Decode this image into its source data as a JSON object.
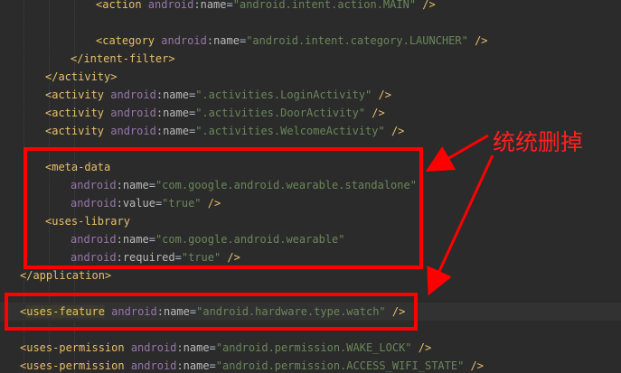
{
  "annotation": {
    "note_text": "统统删掉",
    "color": "#ff0000"
  },
  "code_lines": [
    {
      "indent": 106,
      "tokens": [
        {
          "t": "tag",
          "v": "<action "
        },
        {
          "t": "ns",
          "v": "android"
        },
        {
          "t": "eq",
          "v": ":"
        },
        {
          "t": "attr",
          "v": "name"
        },
        {
          "t": "eq",
          "v": "="
        },
        {
          "t": "val",
          "v": "\"android.intent.action.MAIN\""
        },
        {
          "t": "tag",
          "v": " />"
        }
      ]
    },
    {
      "indent": 0,
      "tokens": []
    },
    {
      "indent": 106,
      "tokens": [
        {
          "t": "tag",
          "v": "<category "
        },
        {
          "t": "ns",
          "v": "android"
        },
        {
          "t": "eq",
          "v": ":"
        },
        {
          "t": "attr",
          "v": "name"
        },
        {
          "t": "eq",
          "v": "="
        },
        {
          "t": "val",
          "v": "\"android.intent.category.LAUNCHER\""
        },
        {
          "t": "tag",
          "v": " />"
        }
      ]
    },
    {
      "indent": 78,
      "tokens": [
        {
          "t": "tag",
          "v": "</intent-filter>"
        }
      ]
    },
    {
      "indent": 50,
      "tokens": [
        {
          "t": "tag",
          "v": "</activity>"
        }
      ]
    },
    {
      "indent": 50,
      "tokens": [
        {
          "t": "tag",
          "v": "<activity "
        },
        {
          "t": "ns",
          "v": "android"
        },
        {
          "t": "eq",
          "v": ":"
        },
        {
          "t": "attr",
          "v": "name"
        },
        {
          "t": "eq",
          "v": "="
        },
        {
          "t": "val",
          "v": "\".activities.LoginActivity\""
        },
        {
          "t": "tag",
          "v": " />"
        }
      ]
    },
    {
      "indent": 50,
      "tokens": [
        {
          "t": "tag",
          "v": "<activity "
        },
        {
          "t": "ns",
          "v": "android"
        },
        {
          "t": "eq",
          "v": ":"
        },
        {
          "t": "attr",
          "v": "name"
        },
        {
          "t": "eq",
          "v": "="
        },
        {
          "t": "val",
          "v": "\".activities.DoorActivity\""
        },
        {
          "t": "tag",
          "v": " />"
        }
      ]
    },
    {
      "indent": 50,
      "tokens": [
        {
          "t": "tag",
          "v": "<activity "
        },
        {
          "t": "ns",
          "v": "android"
        },
        {
          "t": "eq",
          "v": ":"
        },
        {
          "t": "attr",
          "v": "name"
        },
        {
          "t": "eq",
          "v": "="
        },
        {
          "t": "val",
          "v": "\".activities.WelcomeActivity\""
        },
        {
          "t": "tag",
          "v": " />"
        }
      ]
    },
    {
      "indent": 0,
      "tokens": []
    },
    {
      "indent": 50,
      "tokens": [
        {
          "t": "tag",
          "v": "<meta-data"
        }
      ]
    },
    {
      "indent": 78,
      "tokens": [
        {
          "t": "ns",
          "v": "android"
        },
        {
          "t": "eq",
          "v": ":"
        },
        {
          "t": "attr",
          "v": "name"
        },
        {
          "t": "eq",
          "v": "="
        },
        {
          "t": "val",
          "v": "\"com.google.android.wearable.standalone\""
        }
      ]
    },
    {
      "indent": 78,
      "tokens": [
        {
          "t": "ns",
          "v": "android"
        },
        {
          "t": "eq",
          "v": ":"
        },
        {
          "t": "attr",
          "v": "value"
        },
        {
          "t": "eq",
          "v": "="
        },
        {
          "t": "val",
          "v": "\"true\""
        },
        {
          "t": "tag",
          "v": " />"
        }
      ]
    },
    {
      "indent": 50,
      "tokens": [
        {
          "t": "tag",
          "v": "<uses-library"
        }
      ]
    },
    {
      "indent": 78,
      "tokens": [
        {
          "t": "ns",
          "v": "android"
        },
        {
          "t": "eq",
          "v": ":"
        },
        {
          "t": "attr",
          "v": "name"
        },
        {
          "t": "eq",
          "v": "="
        },
        {
          "t": "val",
          "v": "\"com.google.android.wearable\""
        }
      ]
    },
    {
      "indent": 78,
      "tokens": [
        {
          "t": "ns",
          "v": "android"
        },
        {
          "t": "eq",
          "v": ":"
        },
        {
          "t": "attr",
          "v": "required"
        },
        {
          "t": "eq",
          "v": "="
        },
        {
          "t": "val",
          "v": "\"true\""
        },
        {
          "t": "tag",
          "v": " />"
        }
      ]
    },
    {
      "indent": 22,
      "tokens": [
        {
          "t": "tag",
          "v": "</application>"
        }
      ]
    },
    {
      "indent": 0,
      "tokens": []
    },
    {
      "indent": 22,
      "highlight": true,
      "tokens": [
        {
          "t": "tag",
          "v": "<"
        },
        {
          "t": "kw-hl",
          "v": "uses-feature"
        },
        {
          "t": "tag",
          "v": " "
        },
        {
          "t": "ns",
          "v": "android"
        },
        {
          "t": "eq",
          "v": ":"
        },
        {
          "t": "attr",
          "v": "name"
        },
        {
          "t": "eq",
          "v": "="
        },
        {
          "t": "val",
          "v": "\"android.hardware.type.watch\""
        },
        {
          "t": "tag",
          "v": " />"
        }
      ]
    },
    {
      "indent": 0,
      "tokens": []
    },
    {
      "indent": 22,
      "tokens": [
        {
          "t": "tag",
          "v": "<uses-permission "
        },
        {
          "t": "ns",
          "v": "android"
        },
        {
          "t": "eq",
          "v": ":"
        },
        {
          "t": "attr",
          "v": "name"
        },
        {
          "t": "eq",
          "v": "="
        },
        {
          "t": "val",
          "v": "\"android.permission.WAKE_LOCK\""
        },
        {
          "t": "tag",
          "v": " />"
        }
      ]
    },
    {
      "indent": 22,
      "tokens": [
        {
          "t": "tag",
          "v": "<uses-permission "
        },
        {
          "t": "ns",
          "v": "android"
        },
        {
          "t": "eq",
          "v": ":"
        },
        {
          "t": "attr",
          "v": "name"
        },
        {
          "t": "eq",
          "v": "="
        },
        {
          "t": "val",
          "v": "\"android.permission.ACCESS_WIFI_STATE\""
        },
        {
          "t": "tag",
          "v": " />"
        }
      ]
    }
  ]
}
